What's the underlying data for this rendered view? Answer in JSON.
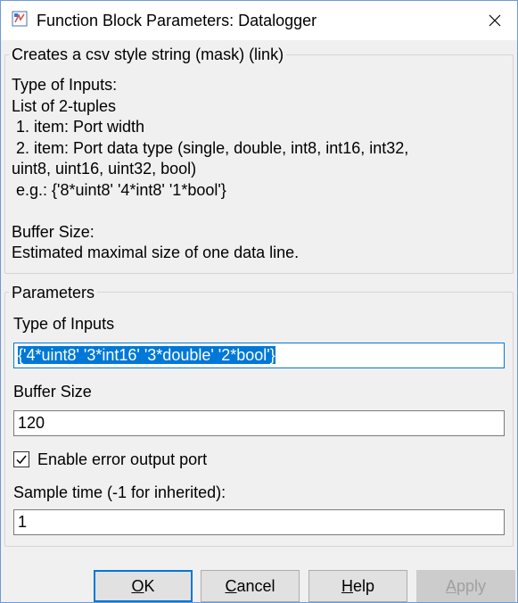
{
  "window": {
    "title": "Function Block Parameters: Datalogger",
    "app_icon": "simulink-block-icon",
    "close_icon": "close-icon"
  },
  "description_group": {
    "title": "Creates a csv style string (mask) (link)",
    "text": "Type of Inputs:\nList of 2-tuples\n 1. item: Port width\n 2. item: Port data type (single, double, int8, int16, int32,\nuint8, uint16, uint32, bool)\n e.g.: {'8*uint8' '4*int8' '1*bool'}\n\nBuffer Size:\nEstimated maximal size of one data line."
  },
  "parameters_group": {
    "title": "Parameters",
    "type_of_inputs": {
      "label": "Type of Inputs",
      "value": "{'4*uint8' '3*int16' '3*double' '2*bool'}"
    },
    "buffer_size": {
      "label": "Buffer Size",
      "value": "120"
    },
    "enable_error_output": {
      "label": "Enable error output port",
      "checked": true
    },
    "sample_time": {
      "label": "Sample time (-1 for inherited):",
      "value": "1"
    }
  },
  "buttons": {
    "ok": {
      "pre": "",
      "accel": "O",
      "post": "K"
    },
    "cancel": {
      "pre": "",
      "accel": "C",
      "post": "ancel"
    },
    "help": {
      "pre": "",
      "accel": "H",
      "post": "elp"
    },
    "apply": {
      "pre": "",
      "accel": "A",
      "post": "pply",
      "enabled": false
    }
  },
  "colors": {
    "accent": "#0078d7",
    "window_border": "#6d9bd6",
    "background": "#f0f0f0"
  }
}
